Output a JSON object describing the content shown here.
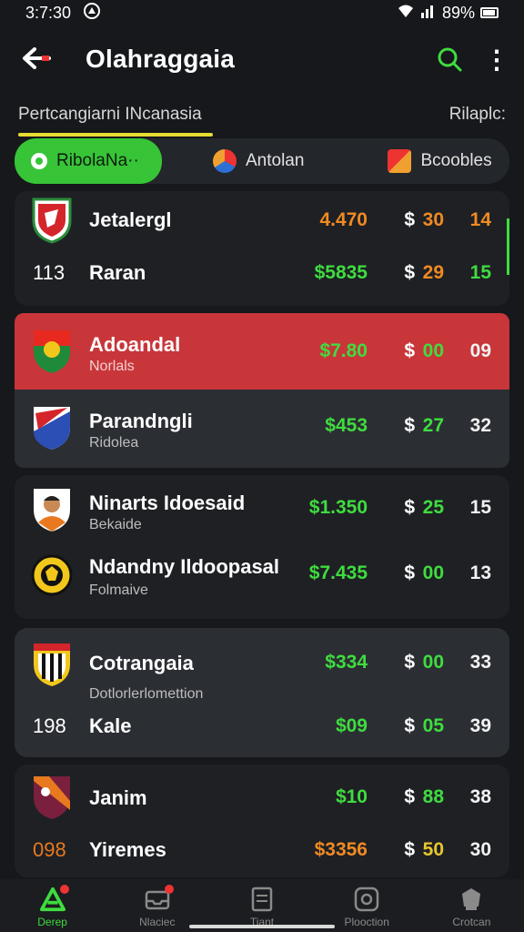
{
  "status": {
    "time": "3:7:30",
    "signal": "▲",
    "battery": "89%"
  },
  "appbar": {
    "title": "Olahraggaia"
  },
  "subheader": {
    "left": "Pertcangiarni INcanasia",
    "right": "Rilaplc:"
  },
  "chips": [
    {
      "label": "RibolaNa··"
    },
    {
      "label": "Antolan"
    },
    {
      "label": "Bcoobles"
    }
  ],
  "cards": [
    {
      "rows": [
        {
          "rank": "",
          "name": "Jetalergl",
          "sub": "",
          "money": "4.470",
          "currency": "$",
          "n1": "30",
          "n2": "14"
        },
        {
          "rank": "113",
          "name": "Raran",
          "sub": "",
          "money": "$5835",
          "currency": "$",
          "n1": "29",
          "n2": "15"
        }
      ]
    },
    {
      "rows": [
        {
          "rank": "",
          "name": "Adoandal",
          "sub": "Norlals",
          "money": "$7.80",
          "currency": "$",
          "n1": "00",
          "n2": "09"
        }
      ]
    },
    {
      "rows": [
        {
          "rank": "",
          "name": "Parandngli",
          "sub": "Ridolea",
          "money": "$453",
          "currency": "$",
          "n1": "27",
          "n2": "32"
        }
      ]
    },
    {
      "rows": [
        {
          "rank": "",
          "name": "Ninarts Idoesaid",
          "sub": "Bekaide",
          "money": "$1.350",
          "currency": "$",
          "n1": "25",
          "n2": "15"
        },
        {
          "rank": "",
          "name": "Ndandny Ildoopasal",
          "sub": "Folmaive",
          "money": "$7.435",
          "currency": "$",
          "n1": "00",
          "n2": "13"
        }
      ]
    },
    {
      "rows": [
        {
          "rank": "",
          "name": "Cotrangaia",
          "sub": "",
          "money": "$334",
          "currency": "$",
          "n1": "00",
          "n2": "33"
        },
        {
          "rank": "",
          "name": "",
          "sub": "Dotlorlerlomettion",
          "money": "",
          "currency": "",
          "n1": "",
          "n2": ""
        },
        {
          "rank": "198",
          "name": "Kale",
          "sub": "",
          "money": "$09",
          "currency": "$",
          "n1": "05",
          "n2": "39"
        }
      ]
    },
    {
      "rows": [
        {
          "rank": "",
          "name": "Janim",
          "sub": "",
          "money": "$10",
          "currency": "$",
          "n1": "88",
          "n2": "38"
        },
        {
          "rank": "098",
          "name": "Yiremes",
          "sub": "",
          "money": "$3356",
          "currency": "$",
          "n1": "50",
          "n2": "30"
        }
      ]
    }
  ],
  "bottomnav": [
    {
      "label": "Derep"
    },
    {
      "label": "Nlaciec"
    },
    {
      "label": "Tiant"
    },
    {
      "label": "Plooction"
    },
    {
      "label": "Crotcan"
    }
  ],
  "colors": {
    "accent": "#37c437",
    "highlight_row": "#c8363a",
    "underline": "#e7dc32"
  }
}
